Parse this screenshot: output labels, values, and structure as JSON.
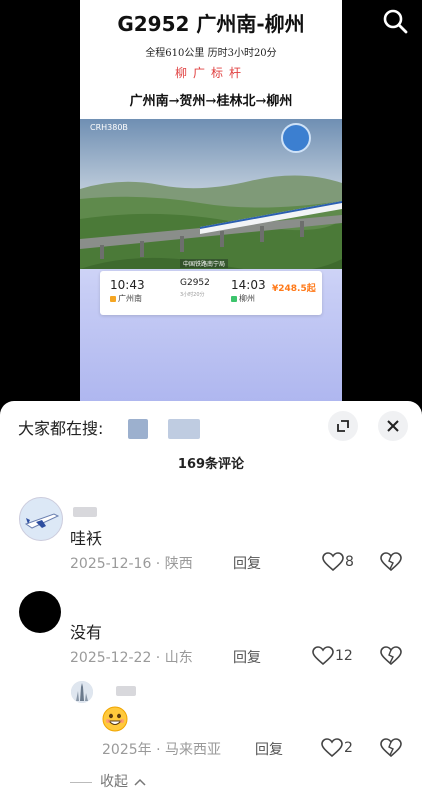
{
  "video": {
    "route_title": "G2952 广州南-柳州",
    "route_sub": "全程610公里  历时3小时20分",
    "route_tag": "柳广标杆",
    "route_stations": "广州南→贺州→桂林北→柳州",
    "train_model": "CRH380B",
    "photo_caption": "中国铁路南宁局",
    "ticket": {
      "dep_time": "10:43",
      "dep_station": "广州南",
      "train_no": "G2952",
      "duration": "3小时20分",
      "arr_time": "14:03",
      "arr_station": "柳州",
      "price": "¥248.5起"
    },
    "search_icon": "search-icon"
  },
  "sheet": {
    "hot_label": "大家都在搜:",
    "count_title": "169条评论",
    "expand_icon": "expand-icon",
    "close_icon": "close-icon"
  },
  "comments": [
    {
      "text": "哇袄",
      "meta": "2025-12-16 · 陕西",
      "reply": "回复",
      "likes": "8"
    },
    {
      "text": "没有",
      "meta": "2025-12-22 · 山东",
      "reply": "回复",
      "likes": "12",
      "replies": [
        {
          "emoji": "smiling-face-emoji",
          "meta": "2025年 · 马来西亚",
          "reply": "回复",
          "likes": "2"
        }
      ]
    }
  ],
  "collapse_label": "收起",
  "colors": {
    "accent_red": "#e04040",
    "price_orange": "#ff7a1a",
    "sheet_bg": "#ffffff"
  }
}
